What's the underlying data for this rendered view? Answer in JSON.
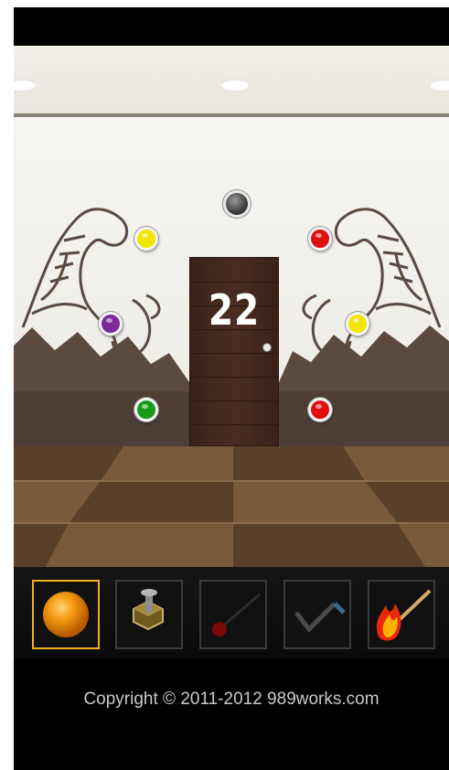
{
  "room": {
    "door_number": "22",
    "colors": {
      "yellow": "#f2e600",
      "red": "#e01010",
      "purple": "#7a2a9a",
      "green": "#1a9a1a",
      "gray": "#555555",
      "selection": "#f0b020"
    },
    "buttons_left": [
      "yellow",
      "purple",
      "green"
    ],
    "buttons_right": [
      "red",
      "yellow",
      "red"
    ],
    "center_button": "gray"
  },
  "inventory": {
    "selected_index": 0,
    "items": [
      {
        "icon": "orange-ball-icon"
      },
      {
        "icon": "metal-bolt-icon"
      },
      {
        "icon": "red-lever-stick-icon"
      },
      {
        "icon": "bent-rod-icon"
      },
      {
        "icon": "burning-match-icon"
      }
    ]
  },
  "footer": {
    "copyright": "Copyright © 2011-2012 989works.com"
  }
}
